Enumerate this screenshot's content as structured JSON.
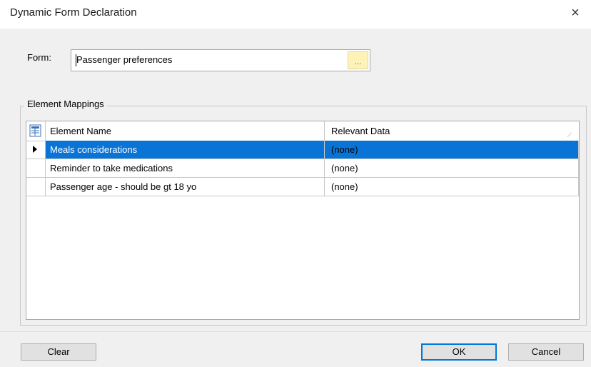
{
  "window": {
    "title": "Dynamic Form Declaration",
    "close_glyph": "×"
  },
  "form": {
    "label": "Form:",
    "value": "Passenger preferences",
    "browse_label": "..."
  },
  "mappings": {
    "group_title": "Element Mappings",
    "columns": [
      "Element Name",
      "Relevant Data"
    ],
    "rows": [
      {
        "name": "Meals considerations",
        "data": "(none)",
        "selected": true
      },
      {
        "name": "Reminder to take medications",
        "data": "(none)",
        "selected": false
      },
      {
        "name": "Passenger age - should be gt 18 yo",
        "data": "(none)",
        "selected": false
      }
    ]
  },
  "buttons": {
    "clear": "Clear",
    "ok": "OK",
    "cancel": "Cancel"
  },
  "colors": {
    "selection": "#0a74d6",
    "browse_button": "#fdf2b8",
    "dialog_bg": "#f0f0f0"
  }
}
